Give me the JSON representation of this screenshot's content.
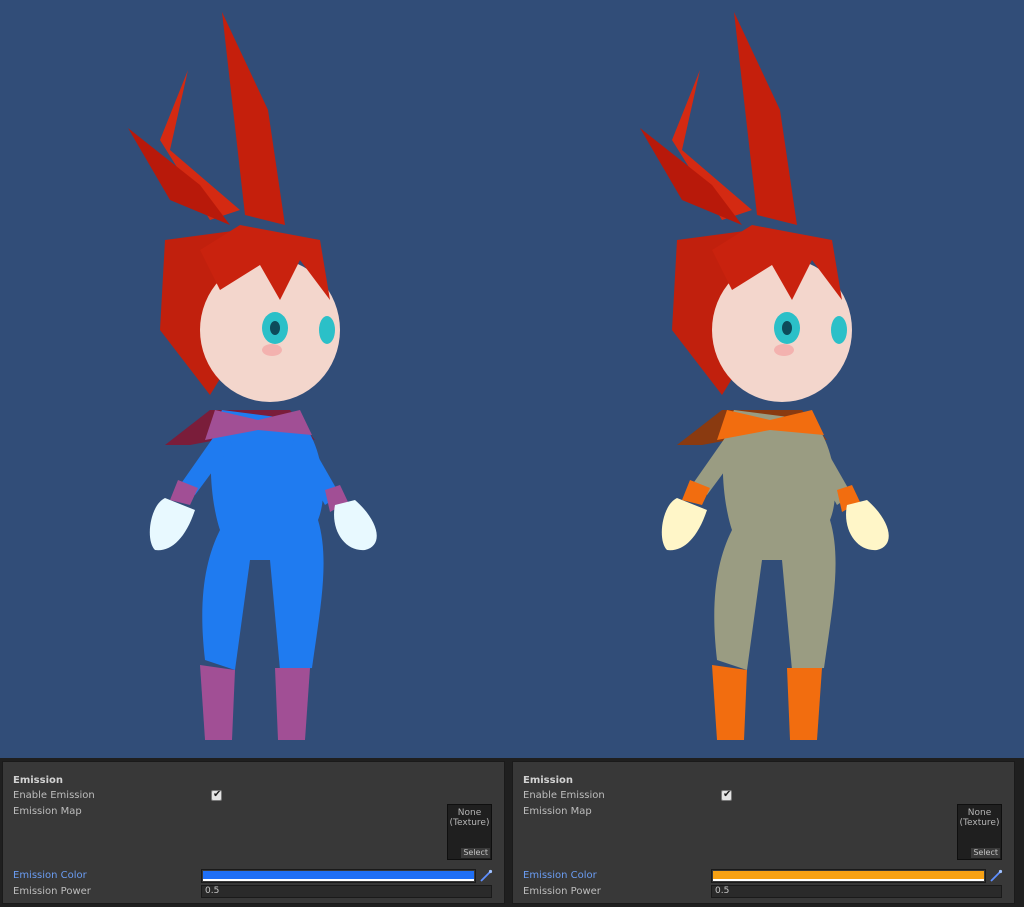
{
  "panels": [
    {
      "title": "Emission",
      "enable_label": "Enable Emission",
      "enabled": true,
      "map_label": "Emission Map",
      "texture_none": "None",
      "texture_kind": "(Texture)",
      "select_label": "Select",
      "color_label": "Emission Color",
      "color": "#1f6ff5",
      "power_label": "Emission Power",
      "power_value": "0.5"
    },
    {
      "title": "Emission",
      "enable_label": "Enable Emission",
      "enabled": true,
      "map_label": "Emission Map",
      "texture_none": "None",
      "texture_kind": "(Texture)",
      "select_label": "Select",
      "color_label": "Emission Color",
      "color": "#f7a114",
      "power_label": "Emission Power",
      "power_value": "0.5"
    }
  ],
  "colors": {
    "viewport_bg": "#314d78",
    "hair": "#c9220e",
    "skin": "#f3d6cc",
    "left_suit": "#1f7bf0",
    "left_accent": "#a14f95",
    "right_suit": "#9a9c82",
    "right_accent": "#f26d0f"
  }
}
